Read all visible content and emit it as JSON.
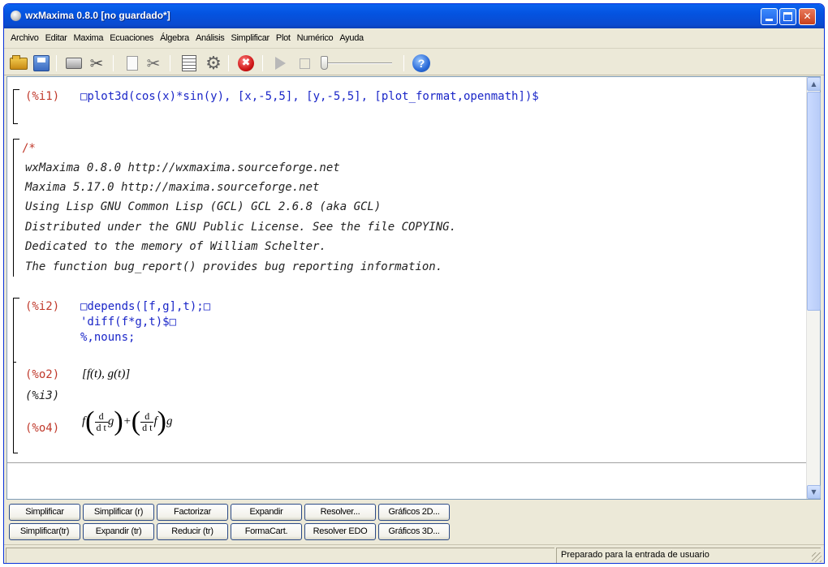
{
  "window": {
    "title": "wxMaxima 0.8.0 [no guardado*]"
  },
  "menu": [
    "Archivo",
    "Editar",
    "Maxima",
    "Ecuaciones",
    "Álgebra",
    "Análisis",
    "Simplificar",
    "Plot",
    "Numérico",
    "Ayuda"
  ],
  "toolbar": {
    "icons": [
      "open-icon",
      "save-icon",
      "print-icon",
      "config-icon",
      "copy-icon",
      "cut-icon",
      "select-all-icon",
      "gear-icon",
      "interrupt-icon",
      "play-icon",
      "stop-icon",
      "animation-slider",
      "help-icon"
    ],
    "stop_glyph": "✖",
    "help_glyph": "?"
  },
  "cells": {
    "c1": {
      "label": "(%i1)",
      "code": "□plot3d(cos(x)*sin(y), [x,-5,5], [y,-5,5], [plot_format,openmath])$"
    },
    "comment": {
      "open": "/*",
      "lines": [
        "wxMaxima 0.8.0 http://wxmaxima.sourceforge.net",
        "Maxima 5.17.0 http://maxima.sourceforge.net",
        "Using Lisp GNU Common Lisp (GCL) GCL 2.6.8 (aka GCL)",
        "Distributed under the GNU Public License. See the file COPYING.",
        "Dedicated to the memory of William Schelter.",
        "The function bug_report() provides bug reporting information."
      ]
    },
    "c2": {
      "label": "(%i2)",
      "lines": [
        "□depends([f,g],t);□",
        "'diff(f*g,t)$□",
        "%,nouns;"
      ]
    },
    "o2": {
      "label": "(%o2)",
      "text": "[f(t), g(t)]"
    },
    "i3": {
      "label": "(%i3)"
    },
    "o4": {
      "label": "(%o4)",
      "f": "f",
      "g": "g",
      "d_num": "d",
      "d_den": "d t",
      "plus": "+"
    }
  },
  "buttons": {
    "row1": [
      "Simplificar",
      "Simplificar (r)",
      "Factorizar",
      "Expandir",
      "Resolver...",
      "Gráficos 2D..."
    ],
    "row2": [
      "Simplificar(tr)",
      "Expandir (tr)",
      "Reducir (tr)",
      "FormaCart.",
      "Resolver EDO",
      "Gráficos 3D..."
    ]
  },
  "status": "Preparado para la entrada de usuario",
  "scroll": {
    "up": "▲",
    "down": "▼"
  }
}
